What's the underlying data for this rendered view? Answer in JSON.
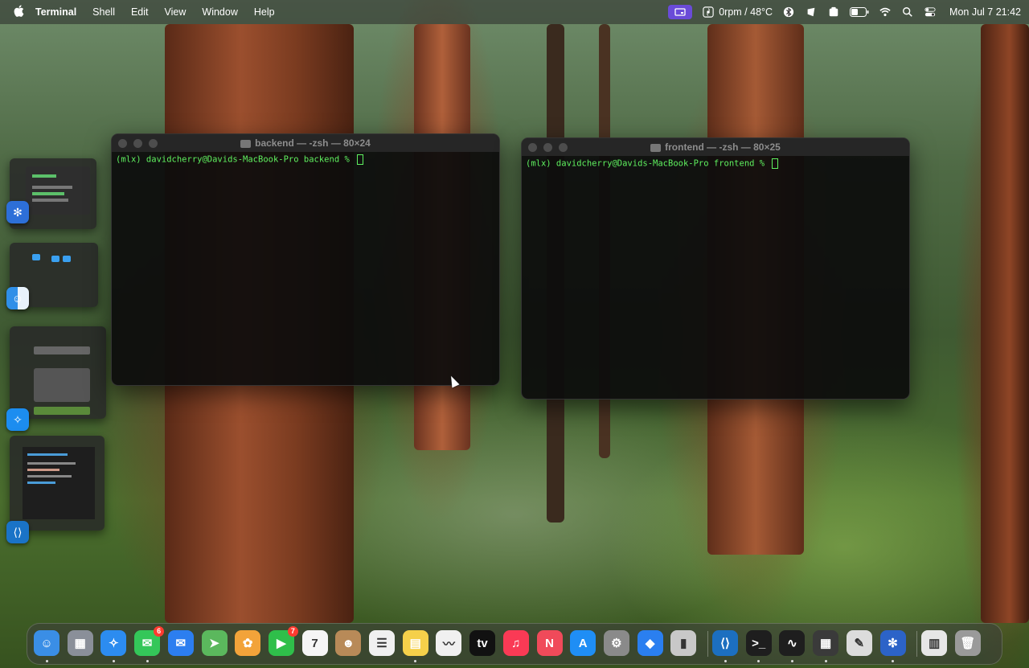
{
  "menubar": {
    "apple_icon": "apple-logo-icon",
    "app_name": "Terminal",
    "menus": [
      "Shell",
      "Edit",
      "View",
      "Window",
      "Help"
    ],
    "status_items": [
      "screen-share-icon",
      "fan-icon",
      "bluetooth-icon",
      "widget-icon",
      "app-icon",
      "battery-icon",
      "wifi-icon",
      "search-icon",
      "control-center-icon"
    ],
    "fan_status": "0rpm / 48°C",
    "clock": "Mon Jul 7  21:42"
  },
  "windows": {
    "backend": {
      "title": "backend — -zsh — 80×24",
      "prompt": "(mlx) davidcherry@Davids-MacBook-Pro backend % "
    },
    "frontend": {
      "title": "frontend — -zsh — 80×25",
      "prompt": "(mlx) davidcherry@Davids-MacBook-Pro frontend % "
    }
  },
  "stage_manager": [
    {
      "app_icon": "fan-control-icon",
      "color": "#2d6fd8"
    },
    {
      "app_icon": "finder-icon",
      "color": "#2f8fe8"
    },
    {
      "app_icon": "safari-icon",
      "color": "#1c8df0"
    },
    {
      "app_icon": "vscode-icon",
      "color": "#1a73c7"
    }
  ],
  "dock": {
    "apps": [
      {
        "name": "finder-icon",
        "glyph": "☺",
        "color": "#3a8ee6",
        "running": true
      },
      {
        "name": "launchpad-icon",
        "glyph": "▦",
        "color": "#8a8f99",
        "running": false
      },
      {
        "name": "safari-icon",
        "glyph": "✧",
        "color": "#2c8cf0",
        "running": true
      },
      {
        "name": "messages-icon",
        "glyph": "✉",
        "color": "#34c759",
        "running": true,
        "badge": "6"
      },
      {
        "name": "mail-icon",
        "glyph": "✉",
        "color": "#2c7ef0",
        "running": false
      },
      {
        "name": "maps-icon",
        "glyph": "➤",
        "color": "#5bb85d",
        "running": false
      },
      {
        "name": "photos-icon",
        "glyph": "✿",
        "color": "#f2a33a",
        "running": false
      },
      {
        "name": "facetime-icon",
        "glyph": "▶",
        "color": "#2fbf4a",
        "running": false,
        "badge": "7"
      },
      {
        "name": "calendar-icon",
        "glyph": "7",
        "color": "#f5f5f5",
        "running": false
      },
      {
        "name": "contacts-icon",
        "glyph": "☻",
        "color": "#b88a58",
        "running": false
      },
      {
        "name": "reminders-icon",
        "glyph": "☰",
        "color": "#f0f0f0",
        "running": false
      },
      {
        "name": "notes-icon",
        "glyph": "▤",
        "color": "#f5d04a",
        "running": true
      },
      {
        "name": "freeform-icon",
        "glyph": "〰",
        "color": "#f0f0f0",
        "running": false
      },
      {
        "name": "apple-tv-icon",
        "glyph": "tv",
        "color": "#111111",
        "running": false
      },
      {
        "name": "music-icon",
        "glyph": "♫",
        "color": "#fa3a55",
        "running": false
      },
      {
        "name": "news-icon",
        "glyph": "N",
        "color": "#f04a5a",
        "running": false
      },
      {
        "name": "app-store-icon",
        "glyph": "A",
        "color": "#1f8ef5",
        "running": false
      },
      {
        "name": "system-settings-icon",
        "glyph": "⚙",
        "color": "#8a8a8a",
        "running": false
      },
      {
        "name": "roblox-icon",
        "glyph": "◆",
        "color": "#2a7ff0",
        "running": false
      },
      {
        "name": "iphone-mirroring-icon",
        "glyph": "▮",
        "color": "#c8c8c8",
        "running": false
      },
      {
        "name": "vscode-icon",
        "glyph": "⟨⟩",
        "color": "#1c6fc0",
        "running": true
      },
      {
        "name": "terminal-icon",
        "glyph": ">_",
        "color": "#1e1e1e",
        "running": true
      },
      {
        "name": "activity-monitor-icon",
        "glyph": "∿",
        "color": "#1e1e1e",
        "running": true
      },
      {
        "name": "calculator-icon",
        "glyph": "▦",
        "color": "#3a3a3a",
        "running": true
      },
      {
        "name": "script-editor-icon",
        "glyph": "✎",
        "color": "#dcdcdc",
        "running": false
      },
      {
        "name": "fan-control-icon",
        "glyph": "✻",
        "color": "#2c63c8",
        "running": true
      },
      {
        "name": "downloads-stack-icon",
        "glyph": "▥",
        "color": "#e6e6e6",
        "running": false
      },
      {
        "name": "trash-icon",
        "glyph": "🗑",
        "color": "#9a9a9a",
        "running": false
      }
    ]
  }
}
